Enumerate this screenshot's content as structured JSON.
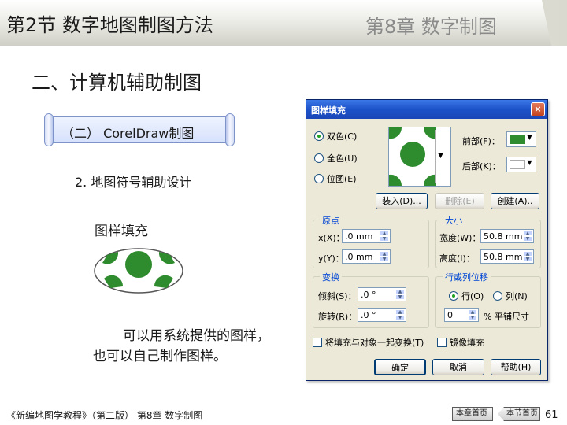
{
  "header": {
    "title": "第2节  数字地图制图方法",
    "chapter": "第8章  数字制图"
  },
  "section_title": "二、计算机辅助制图",
  "scroll_label": "（二） CorelDraw制图",
  "sub_title": "2. 地图符号辅助设计",
  "fill_label": "图样填充",
  "description": {
    "line1": "可以用系统提供的图样，",
    "line2": "也可以自己制作图样。"
  },
  "dialog": {
    "title": "图样填充",
    "close_glyph": "×",
    "radios": [
      {
        "label": "双色(C)",
        "selected": true
      },
      {
        "label": "全色(U)",
        "selected": false
      },
      {
        "label": "位图(E)",
        "selected": false
      }
    ],
    "front_label": "前部(F)：",
    "back_label": "后部(K)：",
    "front_color": "#2e8b2e",
    "back_color": "#ffffff",
    "buttons": {
      "load": "装入(D)...",
      "delete": "删除(E)",
      "create": "创建(A).."
    },
    "origin": {
      "caption": "原点",
      "x_label": "x(X)：",
      "x_value": ".0 mm",
      "y_label": "y(Y)：",
      "y_value": ".0 mm"
    },
    "size": {
      "caption": "大小",
      "width_label": "宽度(W)：",
      "width_value": "50.8 mm",
      "height_label": "高度(I)：",
      "height_value": "50.8 mm"
    },
    "transform": {
      "caption": "变换",
      "skew_label": "倾斜(S)：",
      "skew_value": ".0 °",
      "rotate_label": "旋转(R)：",
      "rotate_value": ".0 °"
    },
    "offset": {
      "caption": "行或列位移",
      "row_label": "行(O)",
      "col_label": "列(N)",
      "value": "0",
      "unit": "% 平铺尺寸"
    },
    "check_transform": "将填充与对象一起变换(T)",
    "check_mirror": "镜像填充",
    "ok": "确定",
    "cancel": "取消",
    "help": "帮助(H)"
  },
  "footer": {
    "text": "《新编地图学教程》（第二版）  第8章  数字制图",
    "chapter_home": "本章首页",
    "section_home": "本节首页",
    "page": "61"
  }
}
